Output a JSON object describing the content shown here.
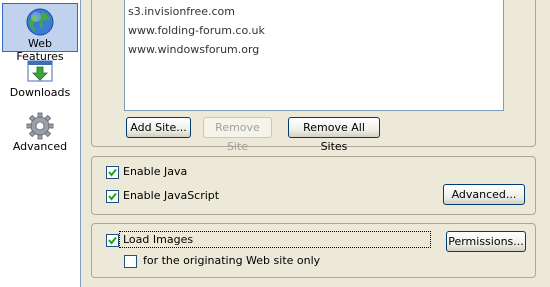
{
  "sidebar": {
    "items": [
      {
        "label": "Web Features",
        "icon": "globe-icon",
        "selected": true
      },
      {
        "label": "Downloads",
        "icon": "downloads-icon",
        "selected": false
      },
      {
        "label": "Advanced",
        "icon": "gear-icon",
        "selected": false
      }
    ]
  },
  "popups": {
    "sites": [
      "s3.invisionfree.com",
      "www.folding-forum.co.uk",
      "www.windowsforum.org"
    ],
    "add_site": "Add Site...",
    "remove_site": "Remove Site",
    "remove_all": "Remove All Sites"
  },
  "java": {
    "enable_java": "Enable Java",
    "enable_java_checked": true,
    "enable_javascript": "Enable JavaScript",
    "enable_javascript_checked": true,
    "advanced_button": "Advanced..."
  },
  "images": {
    "load_images": "Load Images",
    "load_images_checked": true,
    "originating_only": "for the originating Web site only",
    "originating_only_checked": false,
    "permissions_button": "Permissions..."
  },
  "colors": {
    "accent": "#316ac5",
    "check": "#21a121"
  }
}
